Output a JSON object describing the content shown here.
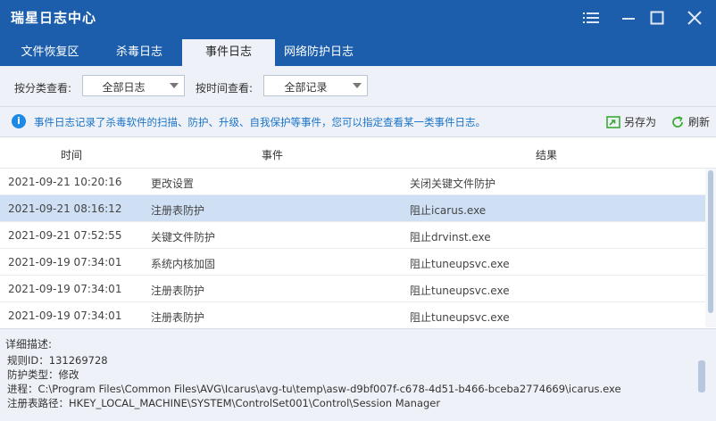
{
  "window": {
    "title": "瑞星日志中心"
  },
  "tabs": [
    {
      "label": "文件恢复区",
      "active": false
    },
    {
      "label": "杀毒日志",
      "active": false
    },
    {
      "label": "事件日志",
      "active": true
    },
    {
      "label": "网络防护日志",
      "active": false
    }
  ],
  "filters": {
    "category_label": "按分类查看:",
    "category_value": "全部日志",
    "time_label": "按时间查看:",
    "time_value": "全部记录"
  },
  "info": {
    "text": "事件日志记录了杀毒软件的扫描、防护、升级、自我保护等事件，您可以指定查看某一类事件日志。",
    "save_as_label": "另存为",
    "refresh_label": "刷新"
  },
  "table": {
    "columns": [
      "时间",
      "事件",
      "结果"
    ],
    "rows": [
      {
        "time": "2021-09-21 10:20:16",
        "event": "更改设置",
        "result": "关闭关键文件防护",
        "selected": false
      },
      {
        "time": "2021-09-21 08:16:12",
        "event": "注册表防护",
        "result": "阻止icarus.exe",
        "selected": true
      },
      {
        "time": "2021-09-21 07:52:55",
        "event": "关键文件防护",
        "result": "阻止drvinst.exe",
        "selected": false
      },
      {
        "time": "2021-09-19 07:34:01",
        "event": "系统内核加固",
        "result": "阻止tuneupsvc.exe",
        "selected": false
      },
      {
        "time": "2021-09-19 07:34:01",
        "event": "注册表防护",
        "result": "阻止tuneupsvc.exe",
        "selected": false
      },
      {
        "time": "2021-09-19 07:34:01",
        "event": "注册表防护",
        "result": "阻止tuneupsvc.exe",
        "selected": false
      }
    ]
  },
  "detail": {
    "title": "详细描述:",
    "lines": [
      "规则ID：131269728",
      "防护类型：修改",
      "进程：C:\\Program Files\\Common Files\\AVG\\Icarus\\avg-tu\\temp\\asw-d9bf007f-c678-4d51-b466-bceba2774669\\icarus.exe",
      "注册表路径：HKEY_LOCAL_MACHINE\\SYSTEM\\ControlSet001\\Control\\Session Manager"
    ]
  },
  "colors": {
    "brand": "#1c5eab",
    "panel": "#eef2f8",
    "selected_row": "#cfe0f5",
    "info_text": "#1a73c8"
  }
}
